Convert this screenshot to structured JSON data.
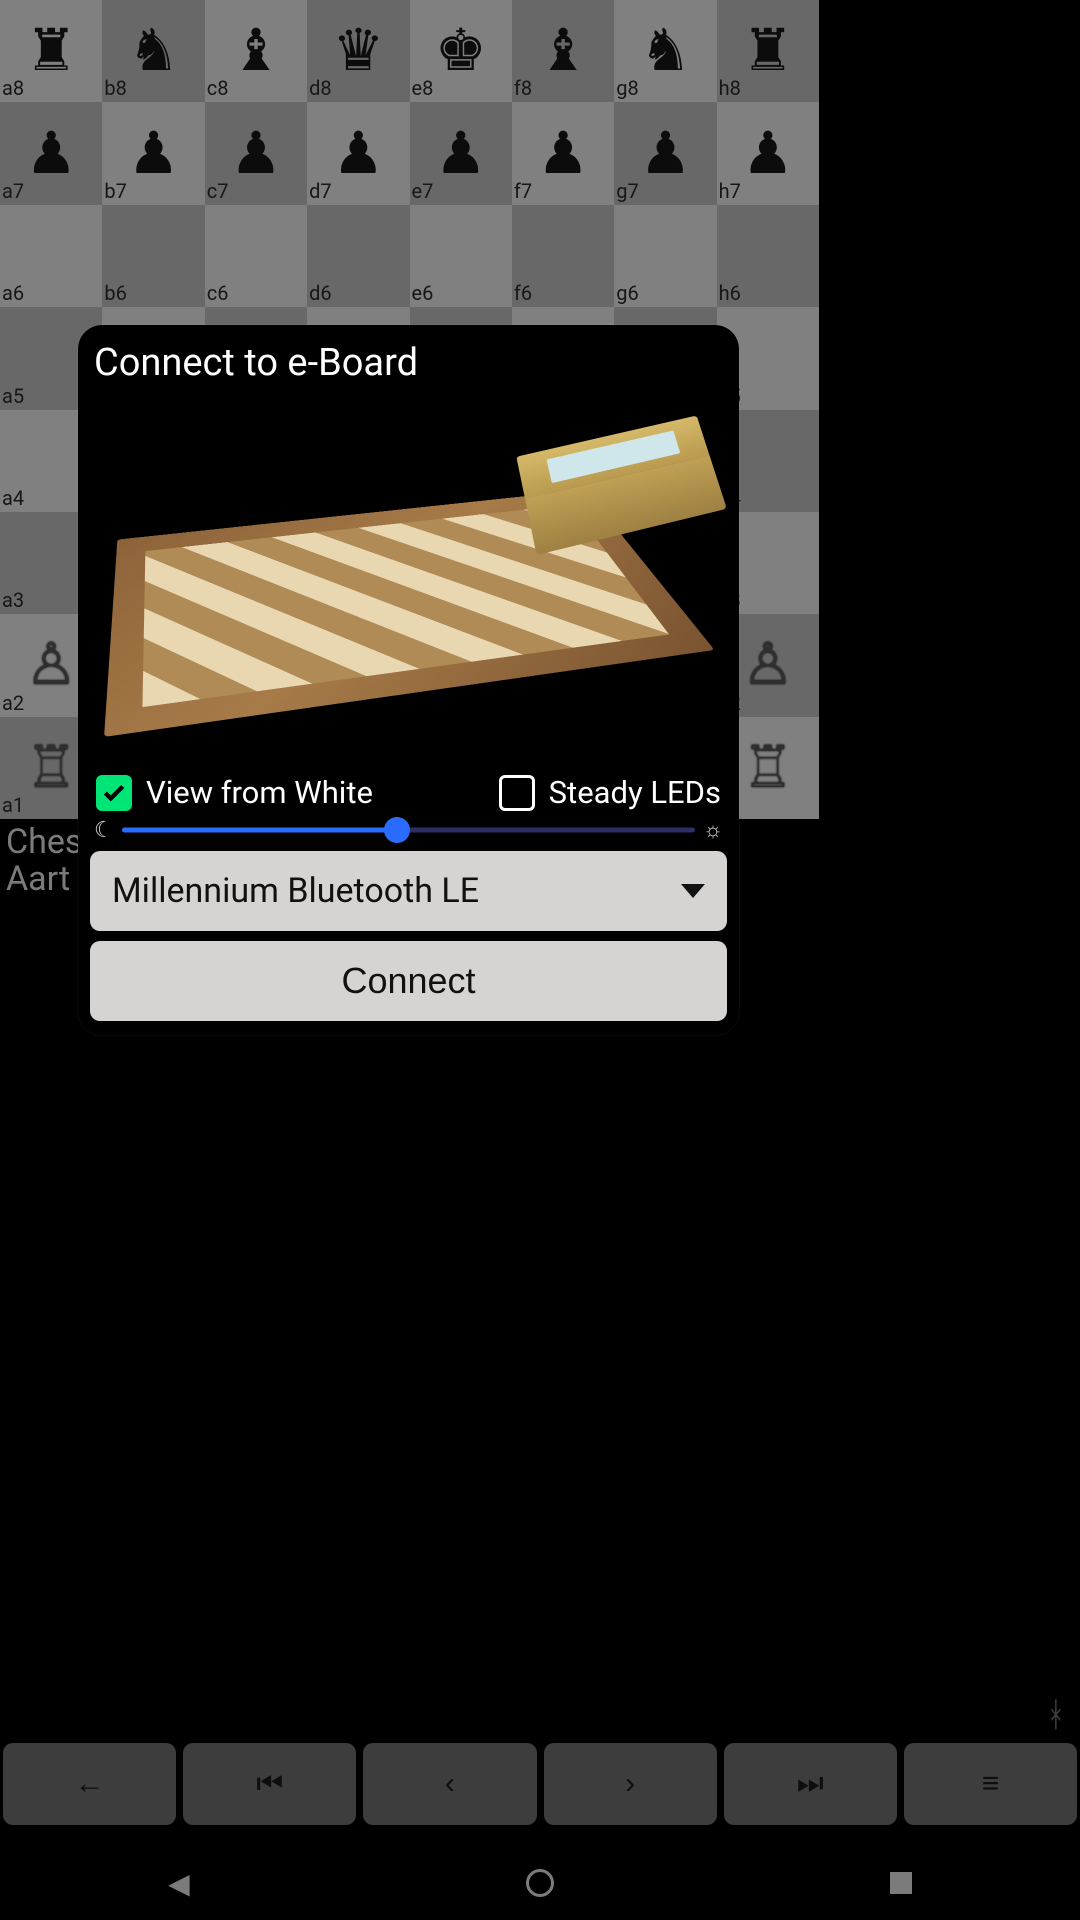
{
  "board": {
    "files": [
      "a",
      "b",
      "c",
      "d",
      "e",
      "f",
      "g",
      "h"
    ],
    "ranks": [
      "8",
      "7",
      "6",
      "5",
      "4",
      "3",
      "2",
      "1"
    ],
    "position": {
      "a8": "br",
      "b8": "bn",
      "c8": "bb",
      "d8": "bq",
      "e8": "bk",
      "f8": "bb",
      "g8": "bn",
      "h8": "br",
      "a7": "bp",
      "b7": "bp",
      "c7": "bp",
      "d7": "bp",
      "e7": "bp",
      "f7": "bp",
      "g7": "bp",
      "h7": "bp",
      "a2": "wp",
      "h2": "wp",
      "a1": "wr",
      "h1": "wr"
    }
  },
  "underBoard": {
    "line1": "Ches",
    "line2": "Aart ."
  },
  "glyphs": {
    "bt": "ᚼ"
  },
  "modal": {
    "title": "Connect to e-Board",
    "viewFromWhite": {
      "label": "View from White",
      "checked": true
    },
    "steadyLeds": {
      "label": "Steady LEDs",
      "checked": false
    },
    "brightnessPercent": 48,
    "deviceSelected": "Millennium Bluetooth LE",
    "connectLabel": "Connect"
  },
  "toolbar": {
    "back": "←",
    "first": "⏮",
    "prev": "‹",
    "next": "›",
    "last": "⏭",
    "menu": "≡"
  },
  "sysnav": {
    "back": "◀"
  }
}
